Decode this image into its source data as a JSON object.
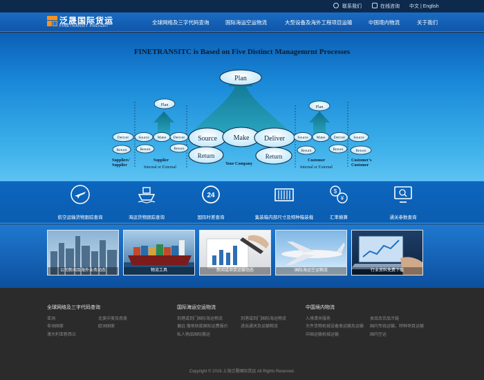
{
  "topbar": {
    "contact": "联系我们",
    "consult": "在线咨询",
    "lang": "中文 | English"
  },
  "logo": {
    "cn": "泛晟国际货运",
    "en": "FINETRANSIT FREIGHT"
  },
  "nav": [
    "全球网络及三字代码查询",
    "国际海运空运物流",
    "大型设备及海外工程项目运输",
    "中国境内物流",
    "关于我们"
  ],
  "hero": {
    "title": "FINETRANSITC is Based on Five Distinct Managemrnt Processes",
    "plan": "Plan",
    "plan_small_left": "Plan",
    "plan_small_right": "Plan",
    "source": "Source",
    "make": "Make",
    "deliver": "Deliver",
    "return": "Return",
    "left_deliver": "Deliver",
    "left_return": "Return",
    "sup_source": "Source",
    "sup_make": "Make",
    "sup_deliver": "Deliver",
    "sup_return1": "Return",
    "sup_return2": "Return",
    "cus_source": "Source",
    "cus_make": "Make",
    "cus_deliver": "Deliver",
    "cus_return1": "Return",
    "cus_return2": "Return",
    "right_source": "Source",
    "right_return": "Return",
    "lbl_suppliers_supplier_1": "Suppliers'",
    "lbl_suppliers_supplier_2": "Supplier",
    "lbl_supplier": "Supplier",
    "lbl_internal_1": "Internal or External",
    "lbl_your_company": "Your Company",
    "lbl_customer": "Customer",
    "lbl_internal_2": "Internal or External",
    "lbl_customers_customer_1": "Customer's",
    "lbl_customers_customer_2": "Customer"
  },
  "services": [
    {
      "label": "航空运输货物跟踪查询",
      "icon": "plane-icon"
    },
    {
      "label": "海运货物跟踪查询",
      "icon": "ship-icon"
    },
    {
      "label": "国际时差查询",
      "icon": "clock-24-icon"
    },
    {
      "label": "集装箱内部尺寸及特种箱装载",
      "icon": "container-icon"
    },
    {
      "label": "汇率换算",
      "icon": "currency-exchange-icon"
    },
    {
      "label": "通关参数查询",
      "icon": "monitor-search-icon"
    }
  ],
  "photos": [
    {
      "caption": "公司新闻及海外业务动态",
      "scene": "city-skyline"
    },
    {
      "caption": "物流工具",
      "scene": "container-ship"
    },
    {
      "caption": "新闻或项目运输动态",
      "scene": "writing-chart"
    },
    {
      "caption": "国际海运空运物流",
      "scene": "airplane"
    },
    {
      "caption": "行业资料免费下载",
      "scene": "laptop-chart"
    }
  ],
  "footer": {
    "col1": {
      "title": "全球网络及三字代码查询",
      "links": [
        "亚洲",
        "北美中美及南美",
        "非洲国家",
        "欧洲国家",
        "澳大利亚新西兰"
      ]
    },
    "col2": {
      "title": "国际海运空运物流",
      "links": [
        "到港或到门国际海运物流",
        "到港或到门国际海运物流",
        "偏远 落地收款国际运费报价",
        "进出通关及运输物流",
        "私人物品国际搬运"
      ]
    },
    "col3": {
      "title": "中国境内物流",
      "links": [
        "入境清关服务",
        "食品及饮品冷链",
        "大件货物机械设备类运输及运输",
        "国内专线运输、特种项目运输",
        "中国运输机械运输",
        "国内空运"
      ]
    },
    "copyright": "Copyright © 2016 上海泛晟国际货运 All Rights Reserved."
  },
  "colors": {
    "brand_orange": "#f6921e",
    "nav_blue": "#1b6cc4",
    "hero_light": "#5cc2f2",
    "footer_bg": "#2b2b2b"
  }
}
